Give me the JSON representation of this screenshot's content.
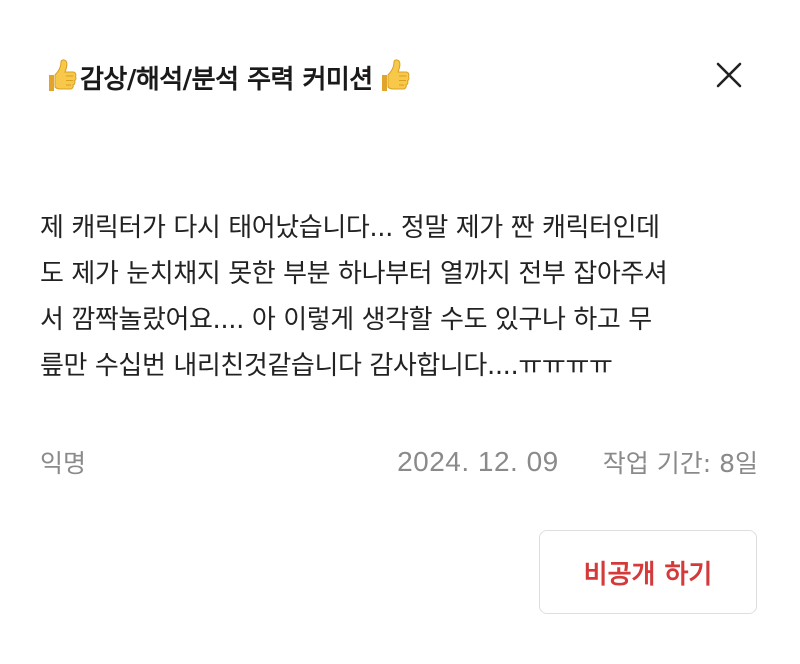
{
  "header": {
    "title": "감상/해석/분석 주력 커미션",
    "left_icon": "thumbs-up-icon",
    "right_icon": "thumbs-up-icon",
    "close_icon": "close-icon"
  },
  "review": {
    "text": "제 캐릭터가 다시 태어났습니다... 정말 제가 짠 캐릭터인데\n도 제가 눈치채지 못한 부분 하나부터 열까지 전부 잡아주셔\n서 깜짝놀랐어요.... 아 이렇게 생각할 수도 있구나 하고 무\n릎만 수십번 내리친것같습니다 감사합니다....ㅠㅠㅠㅠ",
    "author": "익명",
    "date": "2024. 12. 09",
    "work_period": "작업 기간: 8일"
  },
  "actions": {
    "private_label": "비공개 하기"
  },
  "colors": {
    "accent": "#d43a3a",
    "meta_text": "#8a8a8a",
    "emoji": "#f5c542"
  }
}
